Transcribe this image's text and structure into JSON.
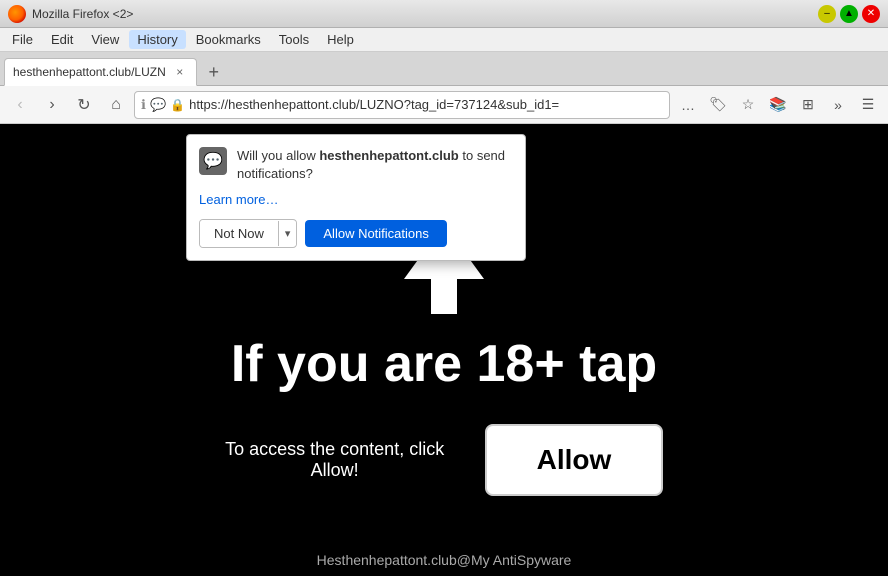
{
  "titlebar": {
    "title": "Mozilla Firefox <2>",
    "min_label": "–",
    "max_label": "▲",
    "close_label": "✕"
  },
  "menubar": {
    "items": [
      {
        "id": "file",
        "label": "File"
      },
      {
        "id": "edit",
        "label": "Edit"
      },
      {
        "id": "view",
        "label": "View"
      },
      {
        "id": "history",
        "label": "History"
      },
      {
        "id": "bookmarks",
        "label": "Bookmarks"
      },
      {
        "id": "tools",
        "label": "Tools"
      },
      {
        "id": "help",
        "label": "Help"
      }
    ]
  },
  "tab": {
    "title": "hesthenhepattont.club/LUZN",
    "close": "×",
    "new_tab": "+"
  },
  "navbar": {
    "back": "‹",
    "forward": "›",
    "reload": "↻",
    "home": "⌂",
    "url": "https://hesthenhepattont.club/LUZNO?tag_id=737124&sub_id1=",
    "more": "…",
    "bookmark": "☆",
    "library": "🗃",
    "sync": "⊞",
    "overflow": "»",
    "hamburger": "☰"
  },
  "notification": {
    "text_before": "Will you allow ",
    "site": "hesthenhepattont.club",
    "text_after": " to send notifications?",
    "learn_more": "Learn more…",
    "not_now_label": "Not Now",
    "dropdown_label": "▾",
    "allow_label": "Allow Notifications"
  },
  "page": {
    "main_text": "If you are 18+ tap",
    "sub_text": "To access the content, click Allow!",
    "allow_btn": "Allow",
    "footer": "Hesthenhepattont.club@My AntiSpyware"
  }
}
